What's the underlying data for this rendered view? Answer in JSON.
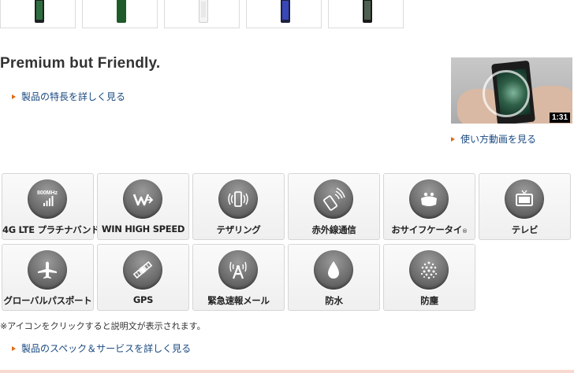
{
  "thumbnails": [
    {
      "color": "black"
    },
    {
      "color": "green"
    },
    {
      "color": "white"
    },
    {
      "color": "navy"
    },
    {
      "color": "dark"
    }
  ],
  "headline": "Premium but Friendly.",
  "links": {
    "features": "製品の特長を詳しく見る",
    "video": "使い方動画を見る",
    "specs": "製品のスペック＆サービスを詳しく見る"
  },
  "video": {
    "duration": "1:31"
  },
  "feature_icons": [
    {
      "label": "4G LTE プラチナバンド",
      "icon": "lte-800mhz-icon",
      "icon_text": "800MHz"
    },
    {
      "label": "WIN HIGH SPEED",
      "icon": "win-high-speed-icon"
    },
    {
      "label": "テザリング",
      "icon": "tethering-icon"
    },
    {
      "label": "赤外線通信",
      "icon": "infrared-icon"
    },
    {
      "label": "おサイフケータイ",
      "label_mark": "®",
      "icon": "osaifu-keitai-icon"
    },
    {
      "label": "テレビ",
      "icon": "tv-icon"
    },
    {
      "label": "グローバルパスポート",
      "icon": "airplane-icon"
    },
    {
      "label": "GPS",
      "icon": "satellite-icon"
    },
    {
      "label": "緊急速報メール",
      "icon": "emergency-alert-icon"
    },
    {
      "label": "防水",
      "icon": "waterproof-drop-icon"
    },
    {
      "label": "防塵",
      "icon": "dustproof-icon"
    }
  ],
  "note": "※アイコンをクリックすると説明文が表示されます。",
  "colors": {
    "link": "#1a4a80",
    "arrow": "#e06a12",
    "icon_bg": "#6e6e6e"
  }
}
